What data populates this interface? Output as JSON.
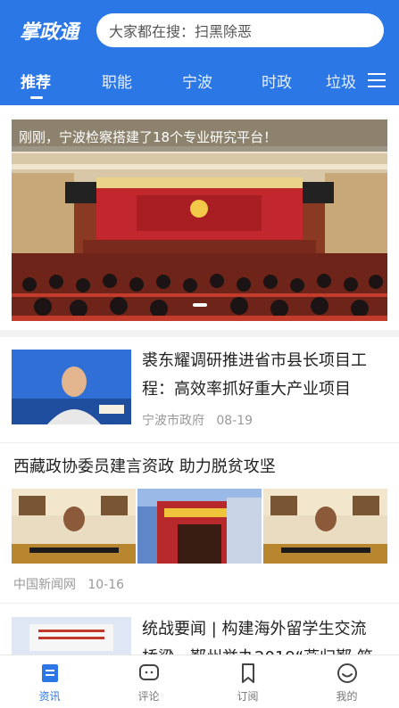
{
  "header": {
    "logo_text": "掌政通",
    "search_placeholder": "大家都在搜：扫黑除恶",
    "tabs": [
      {
        "label": "推荐",
        "active": true
      },
      {
        "label": "职能",
        "active": false
      },
      {
        "label": "宁波",
        "active": false
      },
      {
        "label": "时政",
        "active": false
      },
      {
        "label": "垃圾",
        "active": false
      }
    ],
    "menu_icon": "hamburger-menu-icon"
  },
  "banner": {
    "caption": "刚刚，宁波检察搭建了18个专业研究平台！",
    "slide_count": 1
  },
  "news": [
    {
      "title_line1": "裘东耀调研推进省市县长项目工",
      "title_line2": "程：高效率抓好重大产业项目",
      "source": "宁波市政府",
      "date": "08-19"
    },
    {
      "title": "西藏政协委员建言资政 助力脱贫攻坚",
      "source": "中国新闻网",
      "date": "10-16"
    },
    {
      "title_line1": "统战要闻 | 构建海外留学生交流",
      "title_line2": "桥梁，鄞州举办2019“燕归鄞 筑"
    }
  ],
  "bottom_nav": [
    {
      "label": "资讯",
      "icon": "news-icon",
      "active": true
    },
    {
      "label": "评论",
      "icon": "comment-icon",
      "active": false
    },
    {
      "label": "订阅",
      "icon": "bookmark-icon",
      "active": false
    },
    {
      "label": "我的",
      "icon": "profile-icon",
      "active": false
    }
  ],
  "colors": {
    "brand_blue": "#2b77e6",
    "text_dark": "#222222",
    "text_meta": "#999999",
    "separator": "#f2f2f2"
  }
}
